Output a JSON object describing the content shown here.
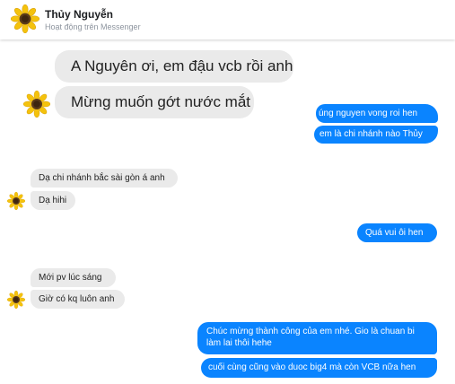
{
  "header": {
    "name": "Thủy Nguyễn",
    "status": "Hoạt động trên Messenger"
  },
  "messages": {
    "m1": "A Nguyên ơi, em đậu vcb rồi anh",
    "m2": "Mừng muốn gớt nước mắt",
    "m3": "úng nguyen vong roi hen",
    "m4": "em là chi nhánh nào Thủy",
    "m5": "Dạ chi nhánh bắc sài gòn á anh",
    "m6": "Dạ hihi",
    "m7": "Quá vui ôi hen",
    "m8": "Mới pv lúc sáng",
    "m9": "Giờ có kq luôn anh",
    "m10_line1": "Chúc mừng thành công của em nhé. Gio là chuan bi",
    "m10_line2": "làm lai thôi hehe",
    "m11": "cuối cùng cũng vào duoc big4 mà còn VCB nữa hen"
  },
  "colors": {
    "outgoing": "#0a84ff",
    "incoming": "#eaeaea"
  },
  "icons": {
    "avatar": "sunflower-avatar"
  }
}
